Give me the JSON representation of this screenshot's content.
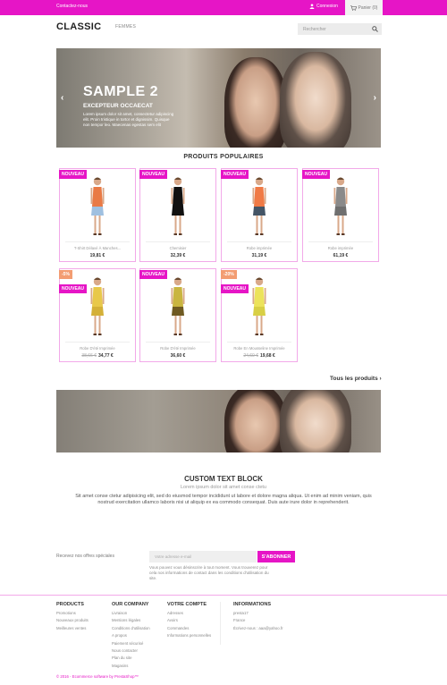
{
  "topbar": {
    "contact": "Contactez-nous",
    "signin": "Connexion",
    "cart": "Panier (0)",
    "bg_color": "#e615c6"
  },
  "header": {
    "logo": "CLASSIC",
    "nav": "FEMMES",
    "search_placeholder": "Rechercher"
  },
  "hero": {
    "title": "SAMPLE 2",
    "subtitle": "EXCEPTEUR OCCAECAT",
    "desc": "Lorem ipsum dolor sit amet, consectetur adipiscing elit. Proin tristique in tortor et dignissim. Quisque non tempor leo. Maecenas egestas sem elit"
  },
  "popular": {
    "title": "PRODUITS POPULAIRES",
    "all_products": "Tous les produits",
    "products": [
      {
        "badge": "NOUVEAU",
        "name": "T-Shirt Délavé À Manches...",
        "price": "19,81 €",
        "old_price": "",
        "discount": "",
        "colors": [
          "#e97a45",
          "#9fc0e0"
        ]
      },
      {
        "badge": "NOUVEAU",
        "name": "Chemisier",
        "price": "32,39 €",
        "old_price": "",
        "discount": "",
        "colors": [
          "#111111",
          "#111111"
        ]
      },
      {
        "badge": "NOUVEAU",
        "name": "Robe imprimée",
        "price": "31,19 €",
        "old_price": "",
        "discount": "",
        "colors": [
          "#f07a45",
          "#445566"
        ]
      },
      {
        "badge": "NOUVEAU",
        "name": "Robe imprimée",
        "price": "61,19 €",
        "old_price": "",
        "discount": "",
        "colors": [
          "#8a8a8a",
          "#6f6f6f"
        ]
      },
      {
        "badge": "NOUVEAU",
        "name": "Robe D'été Imprimée",
        "price": "34,77 €",
        "old_price": "38,66 €",
        "discount": "-5%",
        "colors": [
          "#e8c84a",
          "#d4b038"
        ]
      },
      {
        "badge": "NOUVEAU",
        "name": "Robe D'été Imprimée",
        "price": "36,60 €",
        "old_price": "",
        "discount": "",
        "colors": [
          "#c9b540",
          "#6f5a22"
        ]
      },
      {
        "badge": "NOUVEAU",
        "name": "Robe En Mousseline Imprimée",
        "price": "19,68 €",
        "old_price": "24,60 €",
        "discount": "-20%",
        "colors": [
          "#ece35a",
          "#d8cf45"
        ]
      }
    ]
  },
  "custom_text": {
    "title": "CUSTOM TEXT BLOCK",
    "subtitle": "Lorem ipsum dolor sit amet conse ctetu",
    "body": "Sit amet conse ctetur adipisicing elit, sed do eiusmod tempor incididunt ut labore et dolore magna aliqua. Ut enim ad minim veniam, quis nostrud exercitation ullamco laboris nisi ut aliquip ex ea commodo consequat. Duis aute irure dolor in reprehenderit."
  },
  "newsletter": {
    "label": "Recevez nos offres spéciales",
    "placeholder": "Votre adresse e-mail",
    "button": "S'ABONNER",
    "note": "Vous pouvez vous désinscrire à tout moment. Vous trouverez pour cela nos informations de contact dans les conditions d'utilisation du site."
  },
  "footer": {
    "products": {
      "heading": "PRODUCTS",
      "items": [
        "Promotions",
        "Nouveaux produits",
        "Meilleures ventes"
      ]
    },
    "company": {
      "heading": "OUR COMPANY",
      "items": [
        "Livraison",
        "Mentions légales",
        "Conditions d'utilisation",
        "A propos",
        "Paiement sécurisé",
        "Nous contacter",
        "Plan du site",
        "Magasins"
      ]
    },
    "account": {
      "heading": "VOTRE COMPTE",
      "items": [
        "Adresses",
        "Avoirs",
        "Commandes",
        "Informations personnelles"
      ]
    },
    "info": {
      "heading": "INFORMATIONS",
      "items": [
        "presta17",
        "France",
        "Écrivez-nous : aaa@yahoo.fr"
      ]
    },
    "copyright": "© 2016 - Ecommerce software by PrestaShop™"
  }
}
